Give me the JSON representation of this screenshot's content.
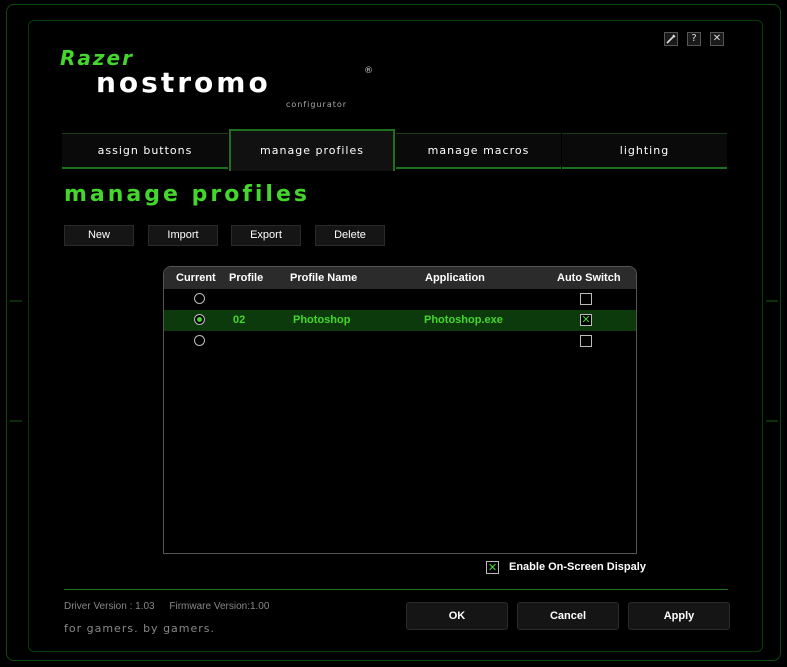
{
  "window": {
    "controls": {
      "settings_icon": "wrench-icon",
      "help_label": "?",
      "close_label": "✕"
    }
  },
  "logo": {
    "brand": "Razer",
    "product": "nostromo",
    "reg": "®",
    "subtitle": "configurator"
  },
  "tabs": [
    {
      "label": "assign buttons",
      "active": false
    },
    {
      "label": "manage profiles",
      "active": true
    },
    {
      "label": "manage macros",
      "active": false
    },
    {
      "label": "lighting",
      "active": false
    }
  ],
  "page_title": "manage profiles",
  "actions": {
    "new": "New",
    "import": "Import",
    "export": "Export",
    "delete": "Delete"
  },
  "table": {
    "headers": {
      "current": "Current",
      "profile": "Profile",
      "profile_name": "Profile Name",
      "application": "Application",
      "auto_switch": "Auto Switch"
    },
    "rows": [
      {
        "current": false,
        "profile": "",
        "name": "",
        "application": "",
        "auto_switch": false
      },
      {
        "current": true,
        "profile": "02",
        "name": "Photoshop",
        "application": "Photoshop.exe",
        "auto_switch": true
      },
      {
        "current": false,
        "profile": "",
        "name": "",
        "application": "",
        "auto_switch": false
      }
    ]
  },
  "osd": {
    "checked": true,
    "label": "Enable On-Screen Dispaly",
    "mark": "✕"
  },
  "footer": {
    "driver_version": "Driver Version : 1.03",
    "firmware_version": "Firmware Version:1.00",
    "tagline": "for gamers. by gamers.",
    "ok": "OK",
    "cancel": "Cancel",
    "apply": "Apply"
  },
  "colors": {
    "accent": "#44d62c",
    "frame": "#1e6f1e",
    "selected_row": "#0d3a0d",
    "background": "#000000"
  }
}
